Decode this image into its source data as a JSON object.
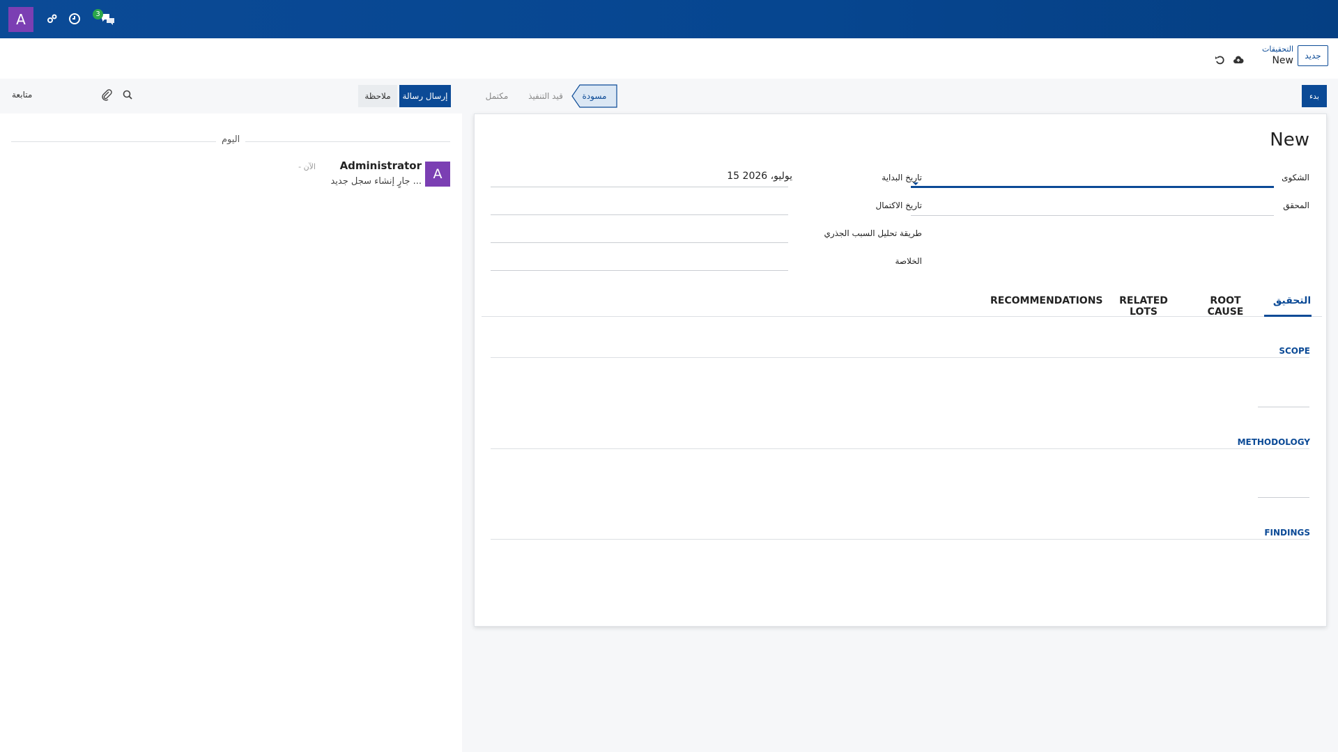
{
  "topbar": {
    "user_initial": "A",
    "notifications_count": "3",
    "icons": [
      "settings-icon",
      "clock-icon",
      "chat-icon"
    ]
  },
  "control": {
    "new_button": "جديد",
    "breadcrumb_parent": "التحقيقات",
    "breadcrumb_current": "New"
  },
  "chatter": {
    "send_message": "إرسال رسالة",
    "log_note": "ملاحظة",
    "follow": "متابعة",
    "today": "اليوم",
    "message": {
      "avatar_initial": "A",
      "author": "Administrator",
      "time": "- الآن",
      "body": "جارٍ إنشاء سجل جديد ..."
    }
  },
  "form": {
    "start_button": "بدء",
    "stages": [
      "مسودة",
      "قيد التنفيذ",
      "مكتمل"
    ],
    "active_stage_index": 0,
    "title": "New",
    "fields": {
      "complaint_label": "الشكوى",
      "investigator_label": "المحقق",
      "start_date_label": "تاريخ البداية",
      "start_date_value": "15 يوليو، 2026",
      "completion_date_label": "تاريخ الاكتمال",
      "root_cause_method_label": "طريقة تحليل السبب الجذري",
      "conclusion_label": "الخلاصة"
    },
    "tabs": [
      "التحقيق",
      "ROOT CAUSE",
      "RELATED LOTS",
      "RECOMMENDATIONS"
    ],
    "sections": [
      "SCOPE",
      "METHODOLOGY",
      "FINDINGS"
    ]
  },
  "colors": {
    "primary": "#0b4a96",
    "avatar": "#7b3fb3",
    "badge": "#2aa64b"
  }
}
